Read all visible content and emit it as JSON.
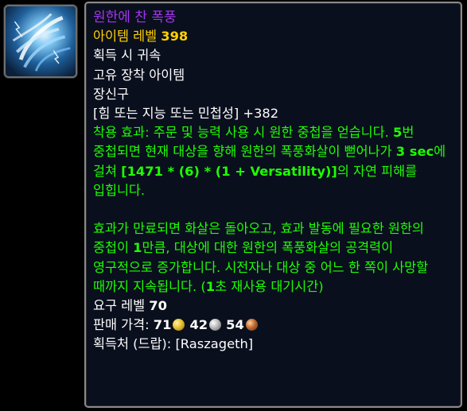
{
  "item": {
    "icon": "storm-vortex-icon",
    "name": "원한에 찬 폭풍",
    "item_level_label": "아이템 레벨",
    "item_level": "398",
    "binding": "획득 시 귀속",
    "unique": "고유 장착 아이템",
    "slot": "장신구",
    "stat": "[힘 또는 지능 또는 민첩성] +382",
    "effect": {
      "p1_a": "착용 효과: 주문 및 능력 사용 시 원한 중첩을 얻습니다. ",
      "p1_b": "5",
      "p1_c": "번 중첩되면 현재 대상을 향해 원한의 폭풍화살이 뻗어나가 ",
      "p1_d": "3 sec",
      "p1_e": "에 걸쳐 ",
      "p1_f": "[1471 * (6) * (1 + Versatility)]",
      "p1_g": "의 자연 피해를 입힙니다.",
      "p2_a": "효과가 만료되면 화살은 돌아오고, 효과 발동에 필요한 원한의 중첩이 ",
      "p2_b": "1",
      "p2_c": "만큼, 대상에 대한 원한의 폭풍화살의 공격력이 영구적으로 증가합니다. 시전자나 대상 중 어느 한 쪽이 사망할 때까지 지속됩니다. (",
      "p2_d": "1",
      "p2_e": "초 재사용 대기시간)"
    },
    "required_level_label": "요구 레벨",
    "required_level": "70",
    "sell_price_label": "판매 가격:",
    "sell_gold": "71",
    "sell_silver": "42",
    "sell_copper": "54",
    "coin_icons": [
      "gold-coin-icon",
      "silver-coin-icon",
      "copper-coin-icon"
    ],
    "source_label": "획득처 (드랍):",
    "source": "[Raszageth]"
  },
  "colors": {
    "epic": "#a335ee",
    "item_level": "#ffd100",
    "effect": "#1eff00",
    "text": "#ffffff",
    "background": "#0a0f1e"
  }
}
